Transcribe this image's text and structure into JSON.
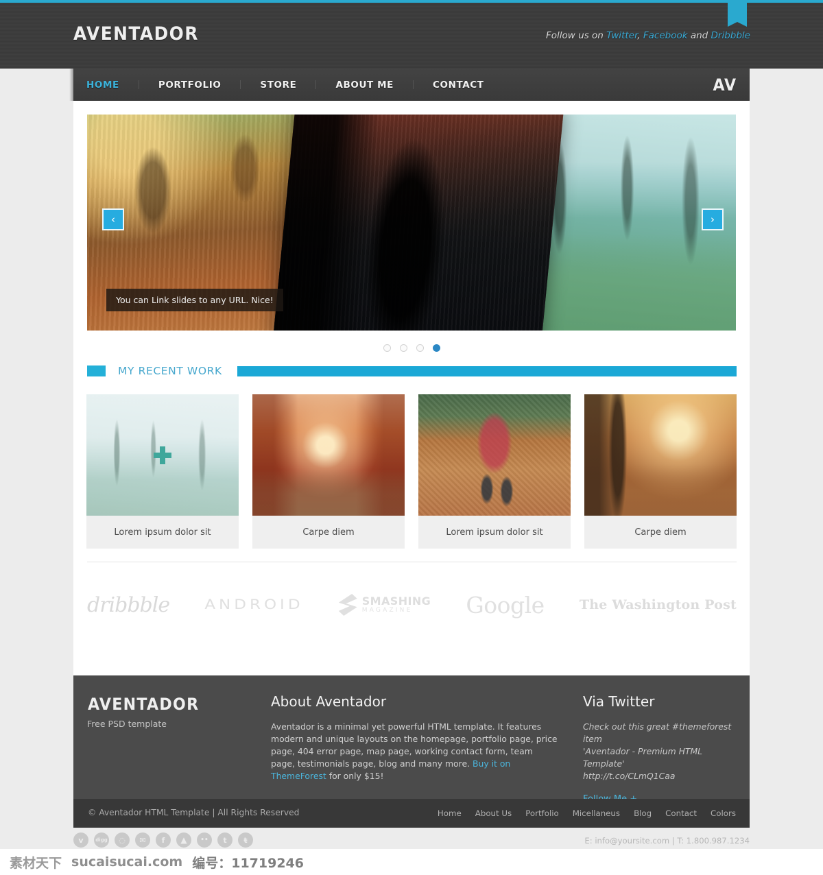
{
  "header": {
    "logo": "AVENTADOR",
    "follow_prefix": "Follow us on ",
    "follow_links": [
      "Twitter",
      "Facebook",
      "Dribbble"
    ],
    "follow_sep1": ", ",
    "follow_sep2": " and ",
    "ribbon_icon": "download-arrow-icon"
  },
  "nav": {
    "items": [
      {
        "label": "HOME",
        "active": true
      },
      {
        "label": "PORTFOLIO",
        "active": false
      },
      {
        "label": "STORE",
        "active": false
      },
      {
        "label": "ABOUT ME",
        "active": false
      },
      {
        "label": "CONTACT",
        "active": false
      }
    ],
    "monogram": "AV",
    "active_color": "#3bb3dc"
  },
  "slider": {
    "caption": "You can Link slides to any URL. Nice!",
    "prev_label": "‹",
    "next_label": "›",
    "dots": 4,
    "active_dot": 4,
    "accent": "#26ace0"
  },
  "recent_work": {
    "title": "MY RECENT WORK",
    "accent": "#1ba8d6",
    "items": [
      {
        "caption": "Lorem ipsum dolor sit"
      },
      {
        "caption": "Carpe diem"
      },
      {
        "caption": "Lorem ipsum dolor sit"
      },
      {
        "caption": "Carpe diem"
      }
    ]
  },
  "clients": {
    "dribbble": "dribbble",
    "android": "ANDROID",
    "smashing_line1": "SMASHING",
    "smashing_line2": "MAGAZINE",
    "google": "Google",
    "washington_post": "The Washington Post"
  },
  "footer": {
    "logo": "AVENTADOR",
    "tagline": "Free PSD template",
    "about_heading": "About Aventador",
    "about_text_1": "Aventador is a minimal yet powerful HTML template. It features modern and unique layouts on the homepage, portfolio page, price page, 404 error page, map page, working contact form, team page, testimonials page, blog and many more. ",
    "about_link": "Buy it on ThemeForest",
    "about_text_2": " for only $15!",
    "twitter_heading": "Via Twitter",
    "tweet_line1": "Check out this great #themeforest item",
    "tweet_line2": "'Aventador - Premium HTML Template'",
    "tweet_url": "http://t.co/CLmQ1Caa",
    "follow_me": "Follow Me +",
    "copyright": "© Aventador HTML Template | All Rights Reserved",
    "nav": [
      "Home",
      "About Us",
      "Portfolio",
      "Micellaneus",
      "Blog",
      "Contact",
      "Colors"
    ],
    "socials": [
      {
        "name": "vimeo-icon",
        "glyph": "v"
      },
      {
        "name": "digg-icon",
        "glyph": "digg"
      },
      {
        "name": "dribbble-icon",
        "glyph": "◌"
      },
      {
        "name": "email-icon",
        "glyph": "✉"
      },
      {
        "name": "facebook-icon",
        "glyph": "f"
      },
      {
        "name": "forrst-icon",
        "glyph": "▲"
      },
      {
        "name": "flickr-icon",
        "glyph": "••"
      },
      {
        "name": "tumblr-icon",
        "glyph": "t"
      },
      {
        "name": "twitter-icon",
        "glyph": "ŧ"
      }
    ],
    "contact": "E: info@yoursite.com | T: 1.800.987.1234"
  },
  "watermark": {
    "brand": "素材天下",
    "site": "sucaisucai.com",
    "number": "编号：11719246"
  }
}
